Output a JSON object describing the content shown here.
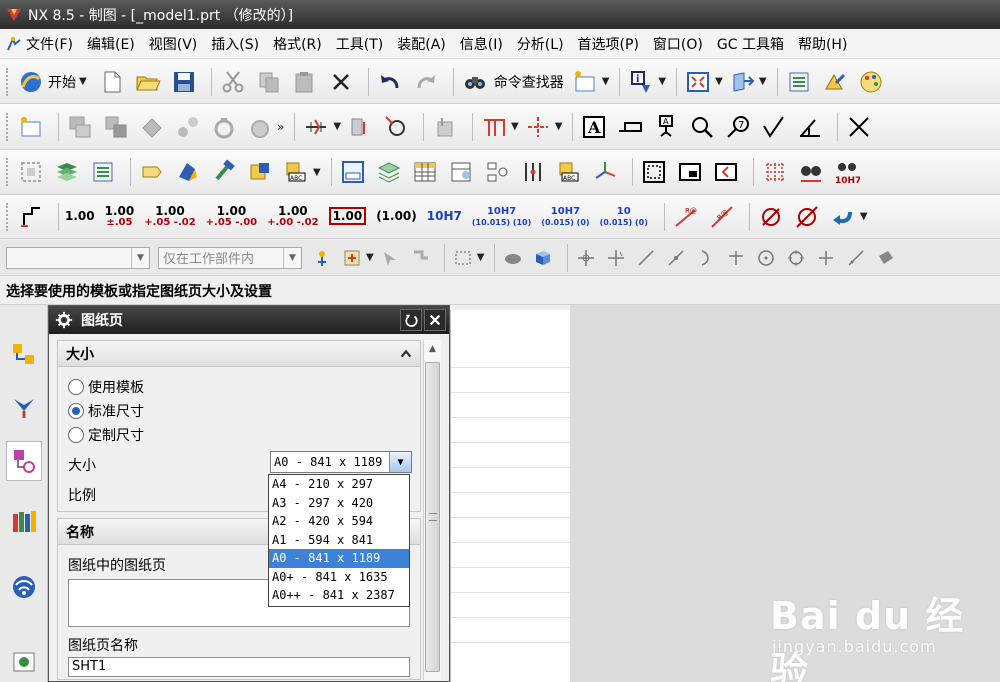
{
  "window": {
    "title": "NX 8.5 - 制图 - [_model1.prt （修改的）]"
  },
  "menu": [
    {
      "label": "文件(F)"
    },
    {
      "label": "编辑(E)"
    },
    {
      "label": "视图(V)"
    },
    {
      "label": "插入(S)"
    },
    {
      "label": "格式(R)"
    },
    {
      "label": "工具(T)"
    },
    {
      "label": "装配(A)"
    },
    {
      "label": "信息(I)"
    },
    {
      "label": "分析(L)"
    },
    {
      "label": "首选项(P)"
    },
    {
      "label": "窗口(O)"
    },
    {
      "label": "GC 工具箱"
    },
    {
      "label": "帮助(H)"
    }
  ],
  "toolbar1": {
    "start_label": "开始",
    "command_finder_label": "命令查找器"
  },
  "toolbar4": {
    "dims": [
      {
        "main": "1.00",
        "sub": ""
      },
      {
        "main": "1.00",
        "sub": "±.05"
      },
      {
        "main": "1.00",
        "sub": "+.05 -.02"
      },
      {
        "main": "1.00",
        "sub": "+.05 -.00"
      },
      {
        "main": "1.00",
        "sub": "+.00 -.02"
      }
    ],
    "boxed_value": "1.00",
    "paren_value": "(1.00)",
    "fits": [
      {
        "top": "10H7",
        "bottom": ""
      },
      {
        "top": "10H7",
        "bottom": "(10.015) (10)"
      },
      {
        "top": "10H7",
        "bottom": "(0.015) (0)"
      },
      {
        "top": "10",
        "bottom": "(0.015) (0)"
      }
    ]
  },
  "toolbar5": {
    "filter_combo": "",
    "scope_combo": "仅在工作部件内"
  },
  "status": {
    "prompt": "选择要使用的模板或指定图纸页大小及设置"
  },
  "dialog": {
    "title": "图纸页",
    "size_group": {
      "header": "大小",
      "options": [
        {
          "label": "使用模板",
          "selected": false
        },
        {
          "label": "标准尺寸",
          "selected": true
        },
        {
          "label": "定制尺寸",
          "selected": false
        }
      ],
      "size_label": "大小",
      "size_value": "A0 - 841 x 1189",
      "scale_label": "比例"
    },
    "name_group": {
      "header": "名称",
      "sheets_label": "图纸中的图纸页",
      "name_label": "图纸页名称",
      "name_value": "SHT1"
    }
  },
  "dropdown": {
    "options": [
      {
        "label": "A4 - 210 x 297",
        "selected": false
      },
      {
        "label": "A3 - 297 x 420",
        "selected": false
      },
      {
        "label": "A2 - 420 x 594",
        "selected": false
      },
      {
        "label": "A1 - 594 x 841",
        "selected": false
      },
      {
        "label": "A0 - 841 x 1189",
        "selected": true
      },
      {
        "label": "A0+ - 841 x 1635",
        "selected": false
      },
      {
        "label": "A0++ - 841 x 2387",
        "selected": false
      }
    ]
  },
  "watermark": {
    "brand": "Bai du 经验",
    "url": "jingyan.baidu.com"
  },
  "colors": {
    "titlebar": "#2c2c2c",
    "selection": "#3b82d8",
    "dim_blue": "#1a3fc2",
    "dim_red": "#b00000"
  }
}
